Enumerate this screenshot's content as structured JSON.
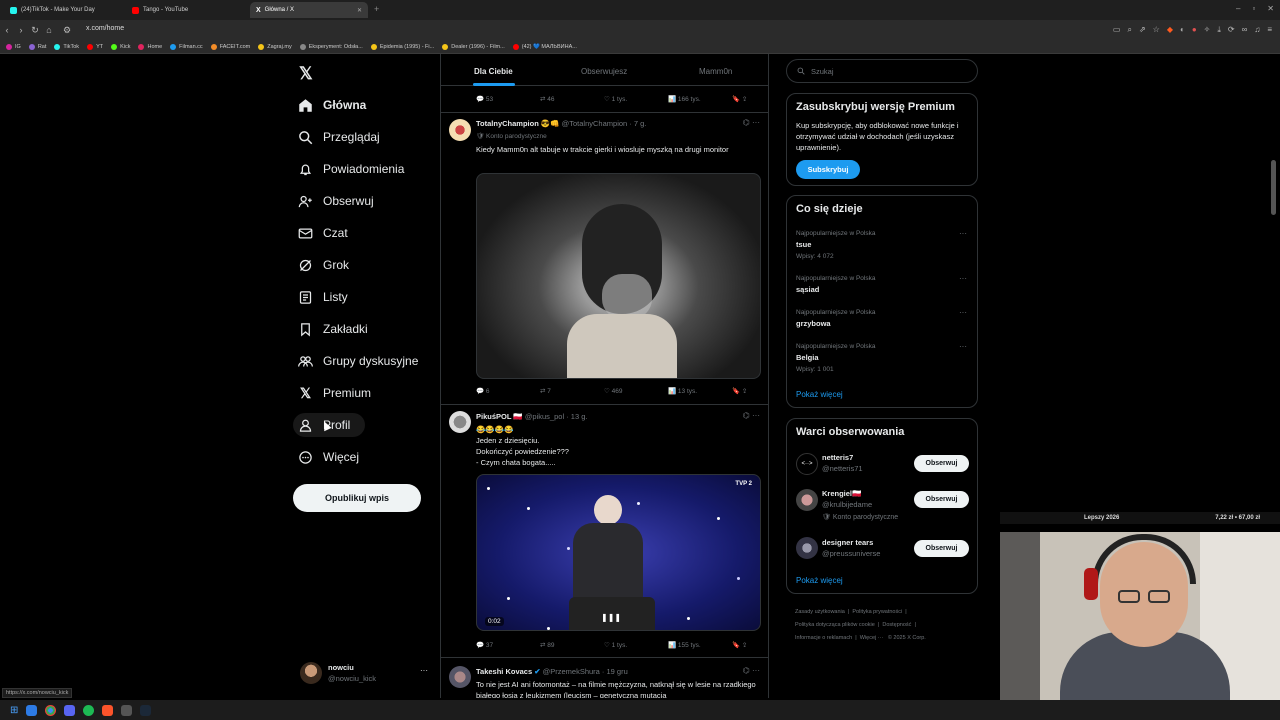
{
  "browser": {
    "tabs": [
      {
        "label": "(24)TikTok - Make Your Day",
        "color": "#25f4ee"
      },
      {
        "label": "Tango - YouTube",
        "color": "#ff0000"
      },
      {
        "label": "Główna / X",
        "color": "#ffffff"
      }
    ],
    "url": "x.com/home",
    "bookmarks": [
      "IG",
      "Rat",
      "TikTok",
      "YT",
      "Kick",
      "Home",
      "Filman.cc",
      "FACEIT.com",
      "Zagraj.my",
      "Eksperyment: Odsła...",
      "Epidemia (1995) - Fi...",
      "Dealer (1996) - Film...",
      "(42) 💙 МАЛЬВИНА..."
    ],
    "status_url": "https://x.com/nowciu_kick"
  },
  "nav": {
    "items": [
      {
        "label": "Główna",
        "icon": "home-icon"
      },
      {
        "label": "Przeglądaj",
        "icon": "search-icon"
      },
      {
        "label": "Powiadomienia",
        "icon": "bell-icon"
      },
      {
        "label": "Obserwuj",
        "icon": "follow-icon"
      },
      {
        "label": "Czat",
        "icon": "mail-icon"
      },
      {
        "label": "Grok",
        "icon": "grok-icon"
      },
      {
        "label": "Listy",
        "icon": "list-icon"
      },
      {
        "label": "Zakładki",
        "icon": "bookmark-icon"
      },
      {
        "label": "Grupy dyskusyjne",
        "icon": "people-icon"
      },
      {
        "label": "Premium",
        "icon": "x-logo-icon"
      },
      {
        "label": "Profil",
        "icon": "person-icon"
      },
      {
        "label": "Więcej",
        "icon": "more-circle-icon"
      }
    ],
    "post_button": "Opublikuj wpis",
    "account": {
      "name": "nowciu",
      "handle": "@nowciu_kick"
    }
  },
  "feed": {
    "tabs": [
      "Dla Ciebie",
      "Obserwujesz",
      "Mamm0n"
    ],
    "top_actions": {
      "replies": "53",
      "reposts": "46",
      "likes": "1 tys.",
      "views": "166 tys."
    },
    "tweets": [
      {
        "name": "TotalnyChampion 😎👊",
        "handle": "@TotalnyChampion · 7 g.",
        "badge": "🛡 Konto parodystyczne",
        "text": "Kiedy Mamm0n alt tabuje w trakcie gierki i wiosluje myszką na drugi monitor",
        "replies": "6",
        "reposts": "7",
        "likes": "469",
        "views": "13 tys."
      },
      {
        "name": "PikuśPOL 🇵🇱",
        "handle": "@pikus_pol · 13 g.",
        "emojis": "😂😂😂😂",
        "lines": [
          "Jeden z dziesięciu.",
          "Dokończyć powiedzenie???",
          "- Czym chata bogata....."
        ],
        "video_time": "0:02",
        "video_logo": "TVP 2",
        "replies": "37",
        "reposts": "89",
        "likes": "1 tys.",
        "views": "155 tys."
      },
      {
        "name": "Takeshi Kovacs",
        "handle": "@PrzemekShura · 19 gru",
        "text": "To nie jest AI ani fotomontaż – na filmie mężczyzna, natknął się w lesie na rzadkiego białego łosia z leukizmem (leucism – genetyczna mutacja"
      }
    ]
  },
  "sidebar": {
    "search_placeholder": "Szukaj",
    "premium": {
      "title": "Zasubskrybuj wersję Premium",
      "text": "Kup subskrypcję, aby odblokować nowe funkcje i otrzymywać udział w dochodach (jeśli uzyskasz uprawnienie).",
      "button": "Subskrybuj"
    },
    "trends": {
      "title": "Co się dzieje",
      "items": [
        {
          "context": "Najpopularniejsze w Polska",
          "topic": "tsue",
          "posts": "Wpisy: 4 072"
        },
        {
          "context": "Najpopularniejsze w Polska",
          "topic": "sąsiad",
          "posts": ""
        },
        {
          "context": "Najpopularniejsze w Polska",
          "topic": "grzybowa",
          "posts": ""
        },
        {
          "context": "Najpopularniejsze w Polska",
          "topic": "Belgia",
          "posts": "Wpisy: 1 001"
        }
      ],
      "show_more": "Pokaż więcej"
    },
    "who_to_follow": {
      "title": "Warci obserwowania",
      "items": [
        {
          "name": "netteris7",
          "handle": "@netteris71",
          "badge": ""
        },
        {
          "name": "Krengiel🇵🇱",
          "handle": "@krulbijedame",
          "badge": "🛡 Konto parodystyczne"
        },
        {
          "name": "designer tears",
          "handle": "@preussuniverse",
          "badge": ""
        }
      ],
      "follow_label": "Obserwuj",
      "show_more": "Pokaż więcej"
    },
    "footer": [
      "Zasady użytkowania",
      "Polityka prywatności",
      "Polityka dotycząca plików cookie",
      "Dostępność",
      "Informacje o reklamach",
      "Więcej ···",
      "© 2025 X Corp."
    ]
  },
  "overlay": {
    "ticker_left": "Lepszy 2026",
    "ticker_right": "7,22 zł • 67,00 zł"
  }
}
